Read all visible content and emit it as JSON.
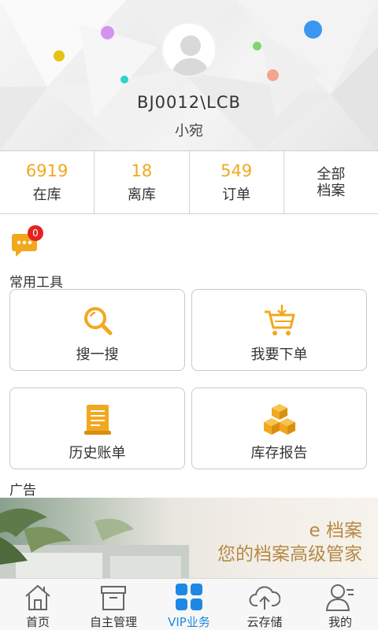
{
  "profile": {
    "user_id": "BJ0012\\LCB",
    "name": "小宛"
  },
  "stats": [
    {
      "value": "6919",
      "label": "在库"
    },
    {
      "value": "18",
      "label": "离库"
    },
    {
      "value": "549",
      "label": "订单"
    }
  ],
  "all_records": {
    "line1": "全部",
    "line2": "档案"
  },
  "messages": {
    "count": "0",
    "icon": "chat-bubble-icon"
  },
  "tools": {
    "title": "常用工具",
    "items": [
      {
        "label": "搜一搜",
        "icon": "search-icon"
      },
      {
        "label": "我要下单",
        "icon": "cart-icon"
      },
      {
        "label": "历史账单",
        "icon": "bill-icon"
      },
      {
        "label": "库存报告",
        "icon": "boxes-icon"
      }
    ]
  },
  "ads": {
    "title": "广告",
    "brand": "e 档案",
    "slogan": "您的档案高级管家"
  },
  "nav": {
    "items": [
      {
        "label": "首页",
        "icon": "home-icon"
      },
      {
        "label": "自主管理",
        "icon": "archive-box-icon"
      },
      {
        "label": "VIP业务",
        "icon": "grid-icon"
      },
      {
        "label": "云存储",
        "icon": "cloud-upload-icon"
      },
      {
        "label": "我的",
        "icon": "user-icon"
      }
    ],
    "active_index": 2
  },
  "colors": {
    "accent": "#f2a81e",
    "active_nav": "#1e88e5",
    "badge": "#e52222",
    "ad_text": "#b58a45"
  }
}
